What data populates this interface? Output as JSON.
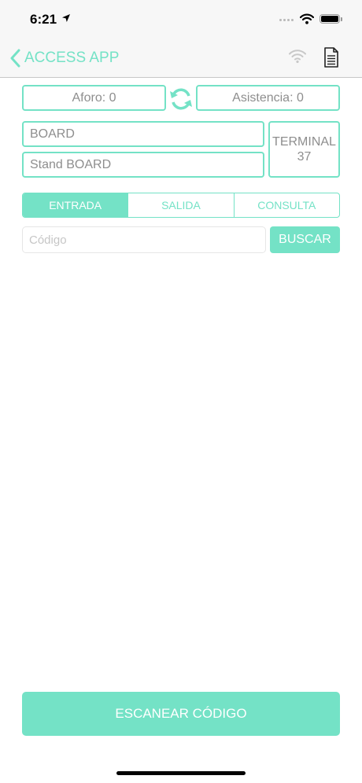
{
  "status_bar": {
    "time": "6:21"
  },
  "navbar": {
    "back_label": "ACCESS APP"
  },
  "counters": {
    "aforo": "Aforo: 0",
    "asistencia": "Asistencia: 0"
  },
  "event": {
    "name": "BOARD",
    "stand": "Stand BOARD"
  },
  "terminal": {
    "label": "TERMINAL",
    "number": "37"
  },
  "tabs": [
    {
      "label": "ENTRADA",
      "active": true
    },
    {
      "label": "SALIDA",
      "active": false
    },
    {
      "label": "CONSULTA",
      "active": false
    }
  ],
  "search": {
    "placeholder": "Código",
    "value": "",
    "button_label": "BUSCAR"
  },
  "scan": {
    "button_label": "ESCANEAR CÓDIGO"
  },
  "colors": {
    "accent": "#74e2c6",
    "text_gray": "#8e8e8e",
    "bar_bg": "#f7f7f7"
  },
  "icons": {
    "location": "location-arrow-icon",
    "wifi": "wifi-icon",
    "battery": "battery-icon",
    "back": "chevron-left-icon",
    "document": "document-icon",
    "refresh": "refresh-icon"
  }
}
